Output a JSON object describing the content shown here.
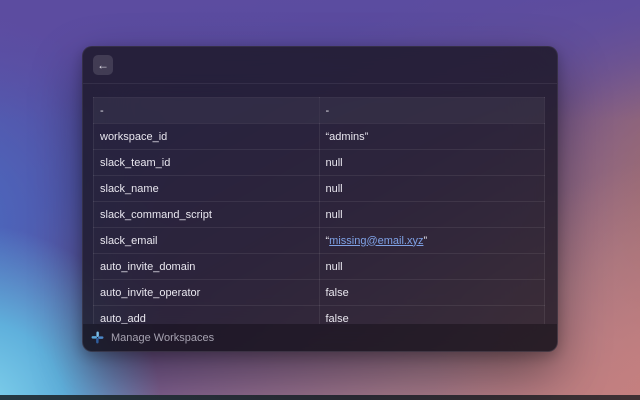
{
  "window": {
    "topbar": {
      "back_label": "←"
    },
    "table": {
      "headers": [
        "-",
        "-"
      ],
      "quote_open": "“",
      "quote_close": "”",
      "rows": [
        {
          "key": "workspace_id",
          "value": "admins",
          "quoted": true,
          "link": false
        },
        {
          "key": "slack_team_id",
          "value": "null",
          "quoted": false,
          "link": false
        },
        {
          "key": "slack_name",
          "value": "null",
          "quoted": false,
          "link": false
        },
        {
          "key": "slack_command_script",
          "value": "null",
          "quoted": false,
          "link": false
        },
        {
          "key": "slack_email",
          "value": "missing@email.xyz",
          "quoted": true,
          "link": true
        },
        {
          "key": "auto_invite_domain",
          "value": "null",
          "quoted": false,
          "link": false
        },
        {
          "key": "auto_invite_operator",
          "value": "false",
          "quoted": false,
          "link": false
        },
        {
          "key": "auto_add",
          "value": "false",
          "quoted": false,
          "link": false
        }
      ]
    },
    "footer": {
      "label": "Manage Workspaces",
      "icon": "slack-pinwheel-icon"
    }
  },
  "colors": {
    "link": "#7fa2e6",
    "text": "#e9e7ef",
    "muted_text": "#a6a2b0"
  }
}
